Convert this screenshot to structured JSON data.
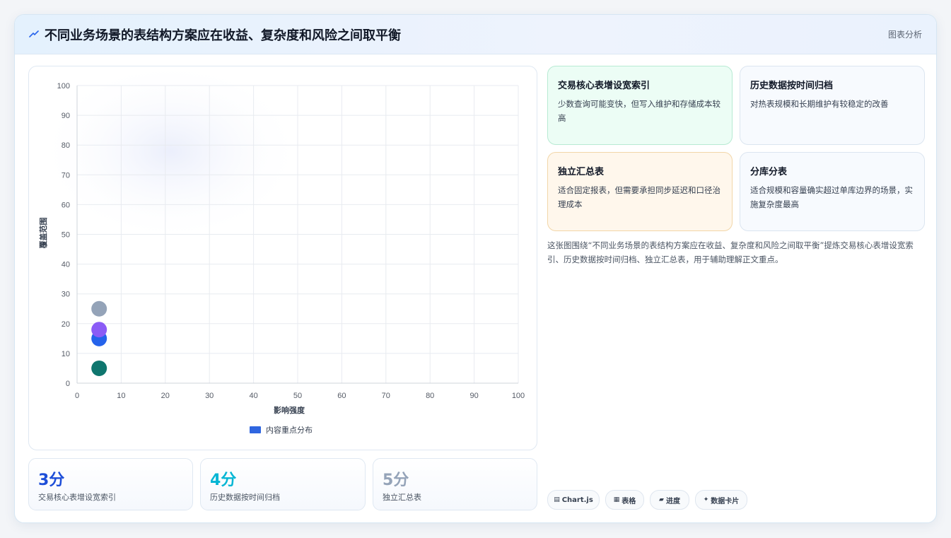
{
  "header": {
    "title": "不同业务场景的表结构方案应在收益、复杂度和风险之间取平衡",
    "tag": "图表分析"
  },
  "chart_data": {
    "type": "scatter",
    "xlabel": "影响强度",
    "ylabel": "覆盖范围",
    "xlim": [
      0,
      100
    ],
    "ylim": [
      0,
      100
    ],
    "xticks": [
      "0",
      "10",
      "20",
      "30",
      "40",
      "50",
      "60",
      "70",
      "80",
      "90",
      "100"
    ],
    "yticks": [
      "0",
      "10",
      "20",
      "30",
      "40",
      "50",
      "60",
      "70",
      "80",
      "90",
      "100"
    ],
    "grid": true,
    "legend_position": "bottom",
    "legend": [
      "内容重点分布"
    ],
    "points": [
      {
        "x": 5,
        "y": 5,
        "color": "#0f766e"
      },
      {
        "x": 5,
        "y": 15,
        "color": "#2563eb"
      },
      {
        "x": 5,
        "y": 18,
        "color": "#8b5cf6"
      },
      {
        "x": 5,
        "y": 25,
        "color": "#94a3b8"
      }
    ],
    "legend_color": "#2f66e0"
  },
  "stats": [
    {
      "value": "3分",
      "label": "交易核心表增设宽索引",
      "color": "#1d4ed8"
    },
    {
      "value": "4分",
      "label": "历史数据按时间归档",
      "color": "#06b6d4"
    },
    {
      "value": "5分",
      "label": "独立汇总表",
      "color": "#94a3b8"
    }
  ],
  "cards": [
    {
      "title": "交易核心表增设宽索引",
      "text": "少数查询可能变快，但写入维护和存储成本较高"
    },
    {
      "title": "历史数据按时间归档",
      "text": "对热表规模和长期维护有较稳定的改善"
    },
    {
      "title": "独立汇总表",
      "text": "适合固定报表，但需要承担同步延迟和口径治理成本"
    },
    {
      "title": "分库分表",
      "text": "适合规模和容量确实超过单库边界的场景，实施复杂度最高"
    }
  ],
  "description": "这张图围绕“不同业务场景的表结构方案应在收益、复杂度和风险之间取平衡”提炼交易核心表增设宽索引、历史数据按时间归档、独立汇总表，用于辅助理解正文重点。",
  "chips": [
    {
      "icon": "chart-icon",
      "label": "Chart.js"
    },
    {
      "icon": "table-icon",
      "label": "表格"
    },
    {
      "icon": "progress-icon",
      "label": "进度"
    },
    {
      "icon": "sparkle-icon",
      "label": "数据卡片"
    }
  ],
  "colors": {
    "accent": "#2563eb",
    "green_card_bg": "#ecfdf5",
    "green_card_border": "#b7ead3",
    "orange_card_bg": "#fff7ec",
    "orange_card_border": "#f2d6a8"
  }
}
